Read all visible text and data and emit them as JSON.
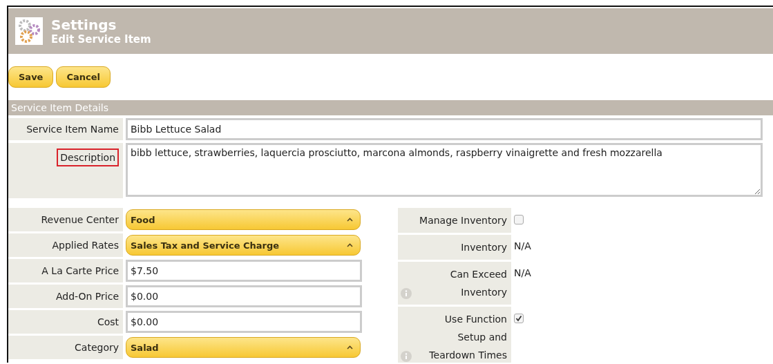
{
  "header": {
    "title": "Settings",
    "subtitle": "Edit Service Item"
  },
  "buttons": [
    "Save",
    "Cancel"
  ],
  "section": {
    "title": "Service Item Details"
  },
  "name_field": {
    "label": "Service Item Name",
    "value": "Bibb Lettuce Salad"
  },
  "description_field": {
    "label": "Description",
    "highlighted": true,
    "value": "bibb lettuce, strawberries, laquercia prosciutto, marcona almonds, raspberry vinaigrette and fresh mozzarella"
  },
  "left_fields": [
    {
      "label": "Revenue Center",
      "kind": "select",
      "value": "Food"
    },
    {
      "label": "Applied Rates",
      "kind": "select",
      "value": "Sales Tax and Service Charge"
    },
    {
      "label": "A La Carte Price",
      "kind": "input",
      "value": "$7.50"
    },
    {
      "label": "Add-On Price",
      "kind": "input",
      "value": "$0.00"
    },
    {
      "label": "Cost",
      "kind": "input",
      "value": "$0.00"
    },
    {
      "label": "Category",
      "kind": "select",
      "value": "Salad"
    }
  ],
  "right_fields": [
    {
      "label": "Manage Inventory",
      "kind": "checkbox",
      "checked": false,
      "info": false
    },
    {
      "label": "Inventory",
      "kind": "text",
      "value": "N/A",
      "info": false
    },
    {
      "label": "Can Exceed Inventory",
      "kind": "text",
      "value": "N/A",
      "info": true
    },
    {
      "label": "Use Function Setup and Teardown Times",
      "kind": "checkbox",
      "checked": true,
      "info": true
    }
  ]
}
